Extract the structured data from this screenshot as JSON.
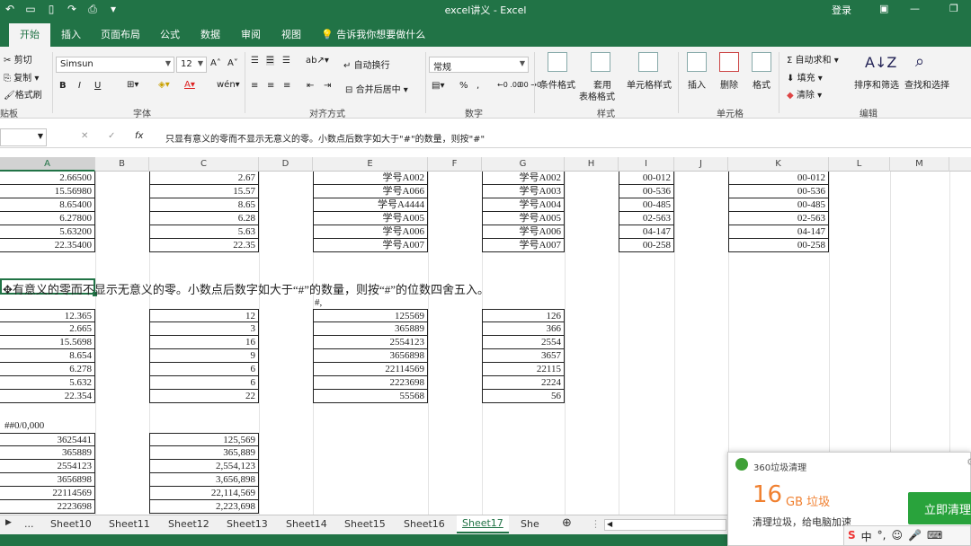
{
  "window": {
    "title": "excel讲义 - Excel",
    "login": "登录"
  },
  "ribbon_tabs": [
    "开始",
    "插入",
    "页面布局",
    "公式",
    "数据",
    "审阅",
    "视图"
  ],
  "tell_me": "告诉我你想要做什么",
  "clipboard": {
    "cut": "剪切",
    "copy": "复制",
    "painter": "格式刷",
    "group": "贴板"
  },
  "font": {
    "name": "Simsun",
    "size": "12",
    "group": "字体",
    "bold": "B",
    "italic": "I",
    "underline": "U"
  },
  "alignment": {
    "wrap": "自动换行",
    "merge": "合并后居中",
    "group": "对齐方式"
  },
  "number": {
    "format": "常规",
    "group": "数字",
    "percent": "%"
  },
  "styles": {
    "conditional": "条件格式",
    "table_line1": "套用",
    "table_line2": "表格格式",
    "cell_styles": "单元格样式",
    "group": "样式"
  },
  "cells": {
    "insert": "插入",
    "delete": "删除",
    "format": "格式",
    "group": "单元格"
  },
  "editing": {
    "autosum": "自动求和",
    "fill": "填充",
    "clear": "清除",
    "sort": "排序和筛选",
    "find": "查找和选择",
    "group": "编辑"
  },
  "formula_bar": {
    "fx": "fx",
    "content": "只显有意义的零而不显示无意义的零。小数点后数字如大于\"#\"的数量，则按\"#\""
  },
  "columns": [
    "A",
    "B",
    "C",
    "D",
    "E",
    "F",
    "G",
    "H",
    "I",
    "J",
    "K",
    "L",
    "M"
  ],
  "block1": {
    "a": [
      "2.66500",
      "15.56980",
      "8.65400",
      "6.27800",
      "5.63200",
      "22.35400"
    ],
    "c": [
      "2.67",
      "15.57",
      "8.65",
      "6.28",
      "5.63",
      "22.35"
    ],
    "e": [
      "学号A002",
      "学号A066",
      "学号A4444",
      "学号A005",
      "学号A006",
      "学号A007"
    ],
    "g": [
      "学号A002",
      "学号A003",
      "学号A004",
      "学号A005",
      "学号A006",
      "学号A007"
    ],
    "i": [
      "00-012",
      "00-536",
      "00-485",
      "02-563",
      "04-147",
      "00-258"
    ],
    "k": [
      "00-012",
      "00-536",
      "00-485",
      "02-563",
      "04-147",
      "00-258"
    ]
  },
  "note_text": "有意义的零而不显示无意义的零。小数点后数字如大于“#”的数量，则按“#”的位数四舍五入。",
  "hash_label": "#,",
  "block2": {
    "a": [
      "12.365",
      "2.665",
      "15.5698",
      "8.654",
      "6.278",
      "5.632",
      "22.354"
    ],
    "c": [
      "12",
      "3",
      "16",
      "9",
      "6",
      "6",
      "22"
    ],
    "e": [
      "125569",
      "365889",
      "2554123",
      "3656898",
      "22114569",
      "2223698",
      "55568"
    ],
    "g": [
      "126",
      "366",
      "2554",
      "3657",
      "22115",
      "2224",
      "56"
    ]
  },
  "format_label": "##0/0,000",
  "block3": {
    "a": [
      "3625441",
      "365889",
      "2554123",
      "3656898",
      "22114569",
      "2223698"
    ],
    "c": [
      "125,569",
      "365,889",
      "2,554,123",
      "3,656,898",
      "22,114,569",
      "2,223,698"
    ]
  },
  "sheets": [
    "...",
    "Sheet10",
    "Sheet11",
    "Sheet12",
    "Sheet13",
    "Sheet14",
    "Sheet15",
    "Sheet16",
    "Sheet17",
    "She"
  ],
  "popup": {
    "title": "360垃圾清理",
    "size": "16",
    "unit": "GB 垃圾",
    "desc": "清理垃圾，给电脑加速",
    "button": "立即清理"
  },
  "ime": {
    "logo": "S",
    "mode": "中"
  },
  "colors": {
    "excel_green": "#217346",
    "popup_orange": "#f08030",
    "popup_button": "#29a33c"
  }
}
